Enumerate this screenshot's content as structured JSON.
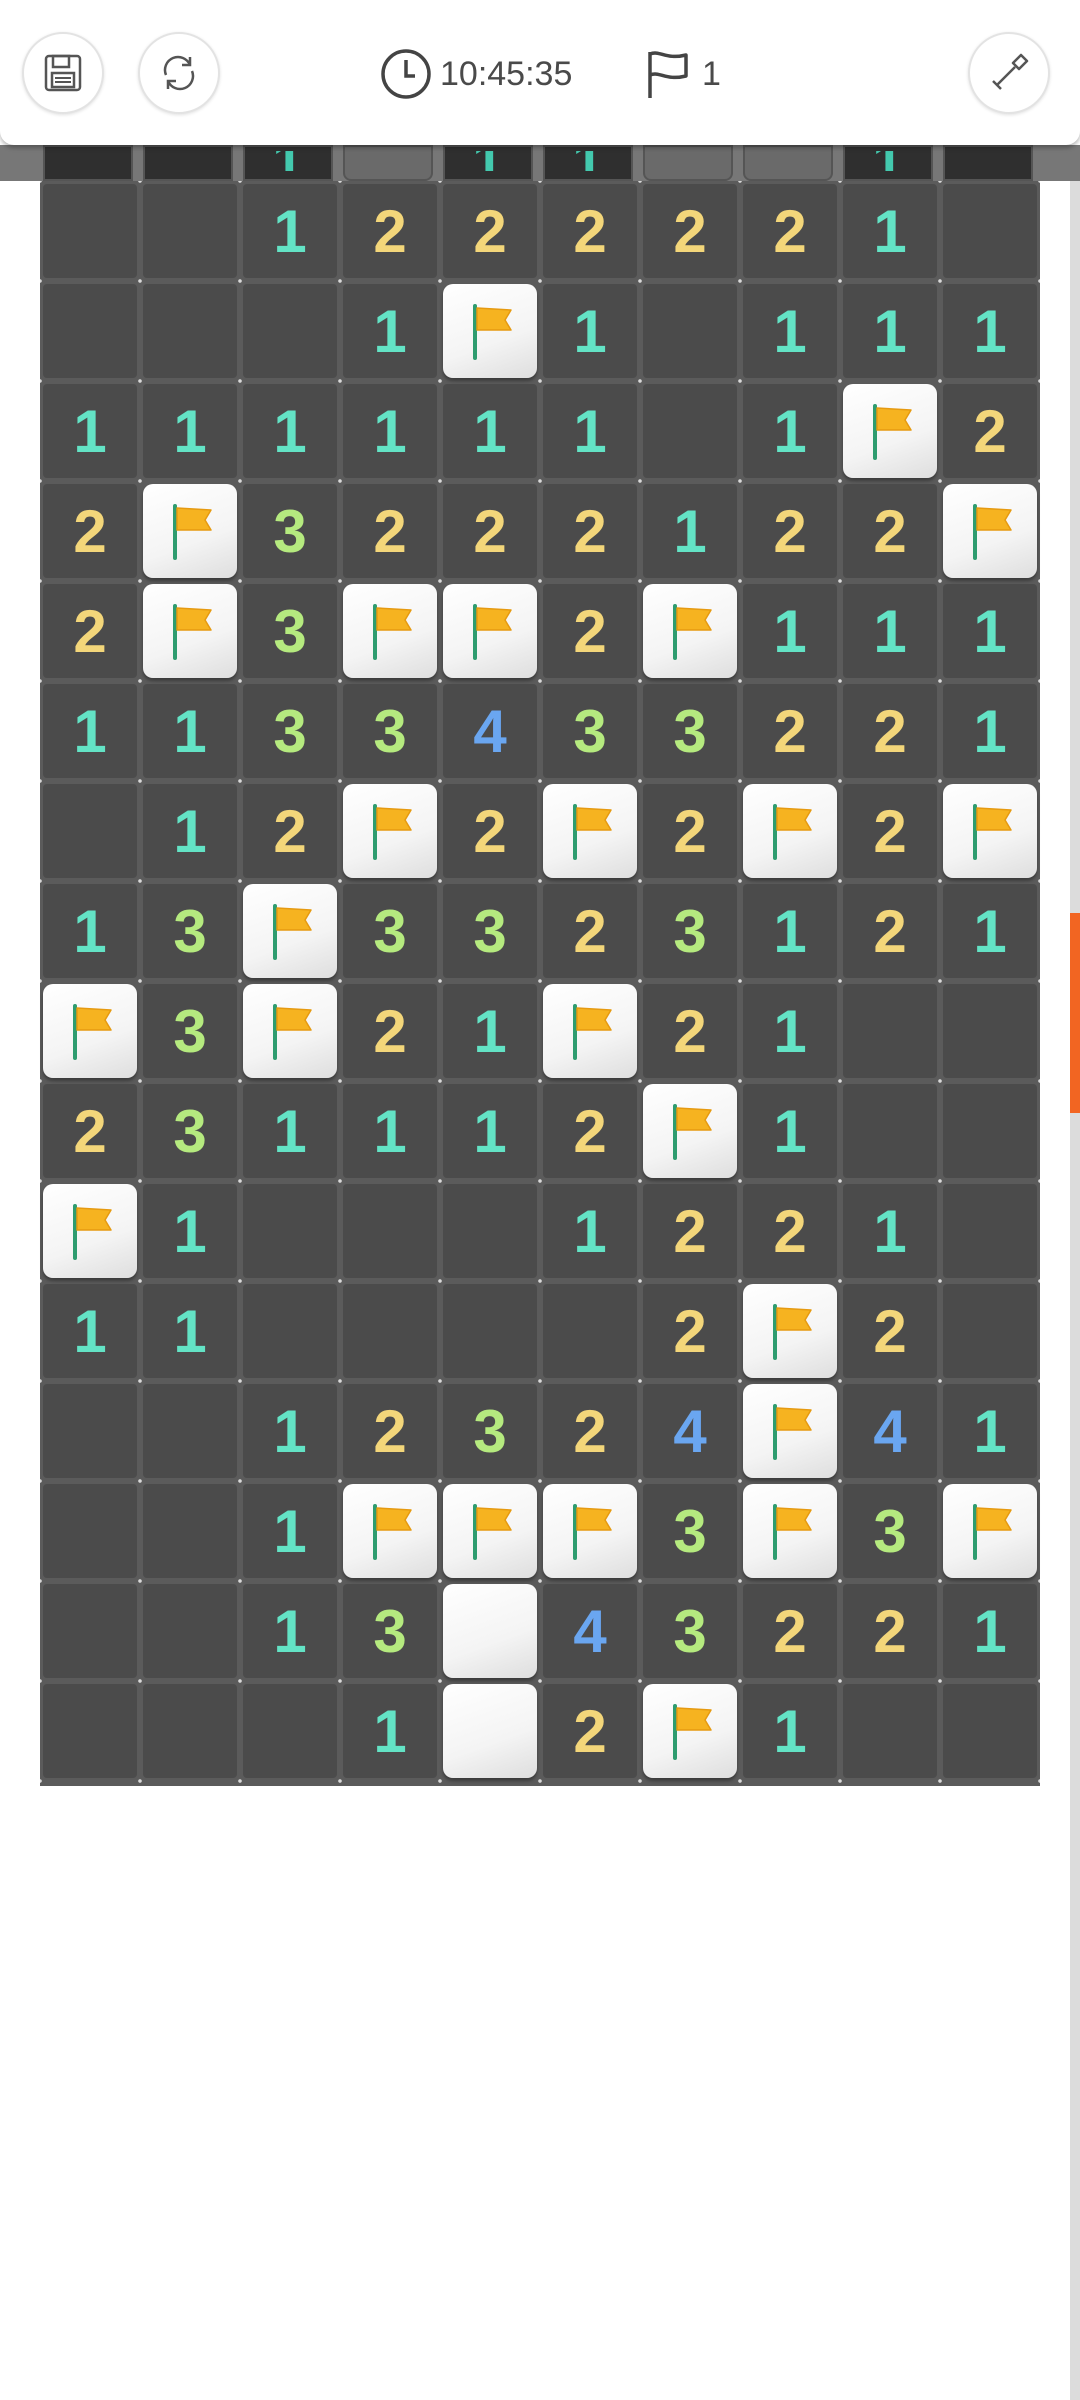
{
  "toolbar": {
    "timer": "10:45:35",
    "flag_count": "1",
    "icons": {
      "save": "save-icon",
      "restart": "restart-icon",
      "clock": "clock-icon",
      "flag": "flag-outline-icon",
      "dig": "shovel-icon"
    }
  },
  "colors": {
    "board": "#5b5b5b",
    "revealed": "#4b4b4b",
    "covered": "#f4f4f4",
    "n1": "#63e3c5",
    "n2": "#f3d67a",
    "n3": "#b5ea7f",
    "n4": "#6aa6f0",
    "flag": "#f6b320",
    "scroll_thumb": "#f26522"
  },
  "board": {
    "columns": 10,
    "peek_row": [
      "",
      "",
      "1",
      "F",
      "1",
      "1",
      "F",
      "F",
      "1",
      ""
    ],
    "rows": [
      [
        "",
        "",
        "1",
        "2",
        "2",
        "2",
        "2",
        "2",
        "1",
        ""
      ],
      [
        "",
        "",
        "",
        "1",
        "F",
        "1",
        "",
        "1",
        "1",
        "1"
      ],
      [
        "1",
        "1",
        "1",
        "1",
        "1",
        "1",
        "",
        "1",
        "F",
        "2"
      ],
      [
        "2",
        "F",
        "3",
        "2",
        "2",
        "2",
        "1",
        "2",
        "2",
        "F"
      ],
      [
        "2",
        "F",
        "3",
        "F",
        "F",
        "2",
        "F",
        "1",
        "1",
        "1"
      ],
      [
        "1",
        "1",
        "3",
        "3",
        "4",
        "3",
        "3",
        "2",
        "2",
        "1"
      ],
      [
        "",
        "1",
        "2",
        "F",
        "2",
        "F",
        "2",
        "F",
        "2",
        "F"
      ],
      [
        "1",
        "3",
        "F",
        "3",
        "3",
        "2",
        "3",
        "1",
        "2",
        "1"
      ],
      [
        "F",
        "3",
        "F",
        "2",
        "1",
        "F",
        "2",
        "1",
        "",
        ""
      ],
      [
        "2",
        "3",
        "1",
        "1",
        "1",
        "2",
        "F",
        "1",
        "",
        ""
      ],
      [
        "F",
        "1",
        "",
        "",
        "",
        "1",
        "2",
        "2",
        "1",
        ""
      ],
      [
        "1",
        "1",
        "",
        "",
        "",
        "",
        "2",
        "F",
        "2",
        ""
      ],
      [
        "",
        "",
        "1",
        "2",
        "3",
        "2",
        "4",
        "F",
        "4",
        "1"
      ],
      [
        "",
        "",
        "1",
        "F",
        "F",
        "F",
        "3",
        "F",
        "3",
        "F"
      ],
      [
        "",
        "",
        "1",
        "3",
        "H",
        "4",
        "3",
        "2",
        "2",
        "1"
      ],
      [
        "",
        "",
        "",
        "1",
        "H",
        "2",
        "F",
        "1",
        "",
        ""
      ]
    ]
  },
  "scroll": {
    "position_fraction": 0.33,
    "visible_fraction": 0.09
  }
}
